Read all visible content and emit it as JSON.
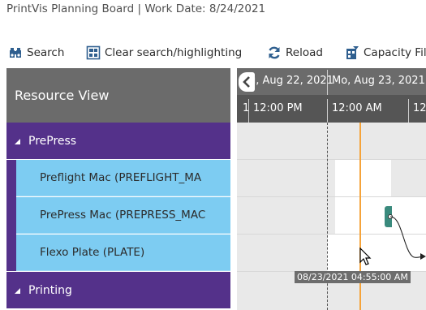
{
  "header": {
    "title": "PrintVis Planning Board | Work Date: 8/24/2021"
  },
  "toolbar": {
    "search_label": "Search",
    "clear_label": "Clear search/highlighting",
    "reload_label": "Reload",
    "capacity_label": "Capacity Fil"
  },
  "resource_view": {
    "header": "Resource View",
    "groups": [
      {
        "name": "PrePress"
      },
      {
        "name": "Printing"
      }
    ],
    "resources": [
      {
        "name": "Preflight Mac (PREFLIGHT_MA"
      },
      {
        "name": "PrePress Mac (PREPRESS_MAC"
      },
      {
        "name": "Flexo Plate (PLATE)"
      }
    ]
  },
  "timeline": {
    "days": [
      "u, Aug 22, 2021",
      "Mo, Aug 23, 2021"
    ],
    "hours": [
      "1",
      "12:00 PM",
      "12:00 AM",
      "12"
    ],
    "tooltip": "08/23/2021 04:55:00 AM"
  },
  "colors": {
    "group_row": "#54318a",
    "resource_row": "#7dccf2",
    "header": "#6b6b6b",
    "now_line": "#f5a33a",
    "job_bar": "#3a8a7d"
  }
}
